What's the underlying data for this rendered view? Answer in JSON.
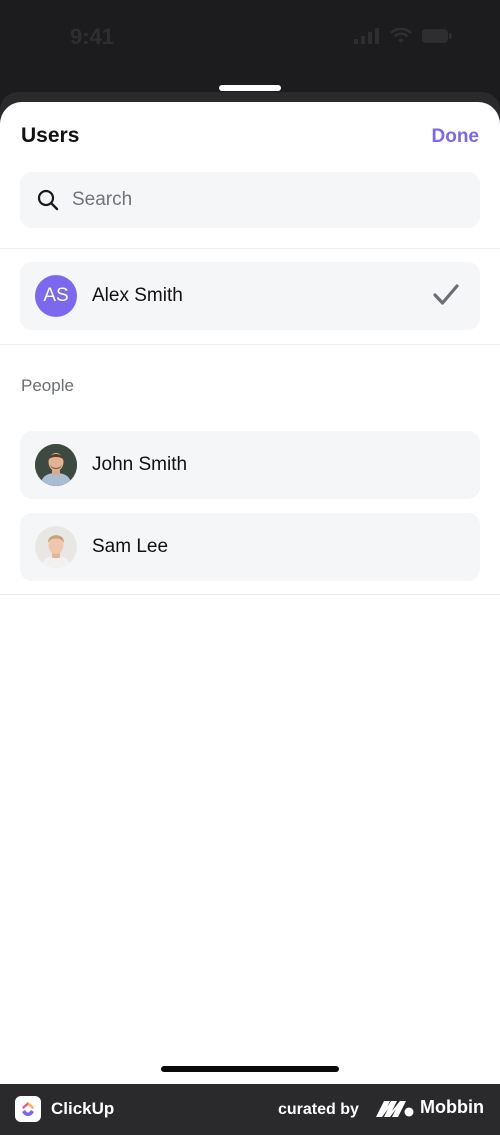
{
  "status_bar": {
    "time": "9:41"
  },
  "sheet": {
    "title": "Users",
    "done_label": "Done"
  },
  "search": {
    "placeholder": "Search"
  },
  "selected": {
    "initials": "AS",
    "name": "Alex Smith",
    "avatar_color": "#7b68ee"
  },
  "people_section": {
    "label": "People",
    "items": [
      {
        "name": "John Smith"
      },
      {
        "name": "Sam Lee"
      }
    ]
  },
  "footer": {
    "app_name": "ClickUp",
    "curated_by": "curated by",
    "brand": "Mobbin"
  },
  "colors": {
    "accent": "#7b68ee",
    "row_background": "#f5f6f8",
    "check": "#6b6e75"
  }
}
